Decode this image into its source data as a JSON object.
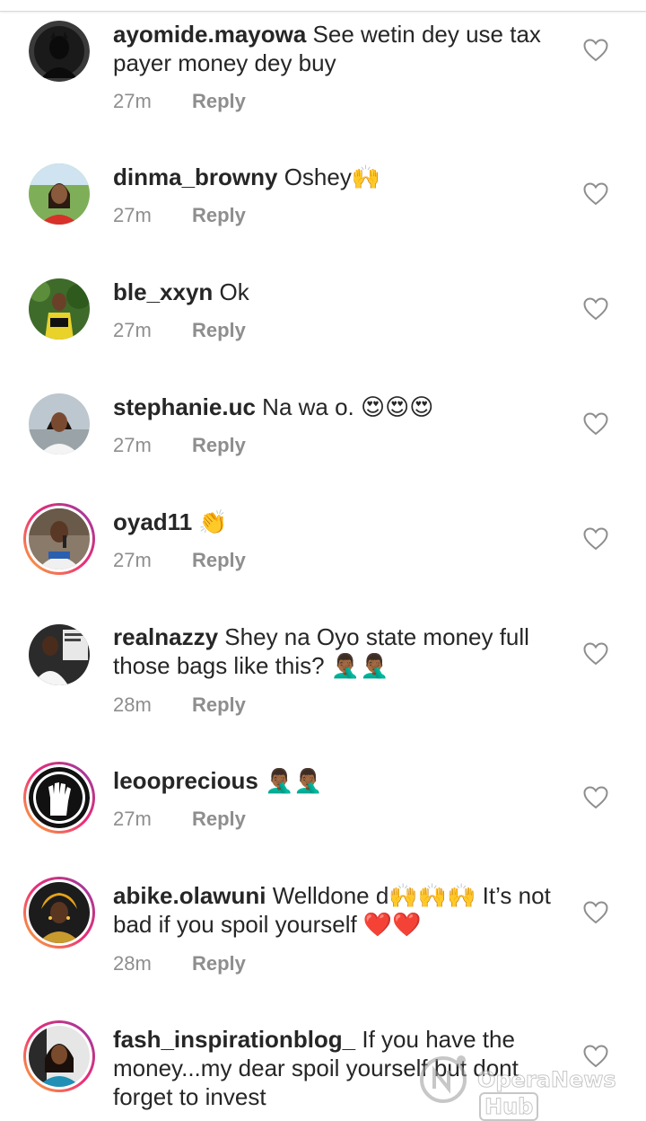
{
  "reply_label": "Reply",
  "comments": [
    {
      "username": "ayomide.mayowa",
      "text": " See wetin dey use tax payer money dey buy",
      "time": "27m"
    },
    {
      "username": "dinma_browny",
      "text": " Oshey🙌",
      "time": "27m"
    },
    {
      "username": "ble_xxyn",
      "text": " Ok",
      "time": "27m"
    },
    {
      "username": "stephanie.uc",
      "text": " Na wa o. 😍😍😍",
      "time": "27m"
    },
    {
      "username": "oyad11",
      "text": " 👏",
      "time": "27m"
    },
    {
      "username": "realnazzy",
      "text": " Shey na Oyo state money full those bags like this? 🤦🏾‍♂️🤦🏾‍♂️",
      "time": "28m"
    },
    {
      "username": "leooprecious",
      "text": " 🤦🏾‍♂️🤦🏾‍♂️",
      "time": "27m"
    },
    {
      "username": "abike.olawuni",
      "text": " Welldone d🙌🙌🙌 It’s not bad if you spoil yourself ❤️❤️",
      "time": "28m"
    },
    {
      "username": "fash_inspirationblog_",
      "text": " If you have the money...my dear spoil yourself but dont forget to invest",
      "time": ""
    }
  ],
  "watermark": {
    "brand": "OperaNews",
    "badge": "Hub"
  }
}
